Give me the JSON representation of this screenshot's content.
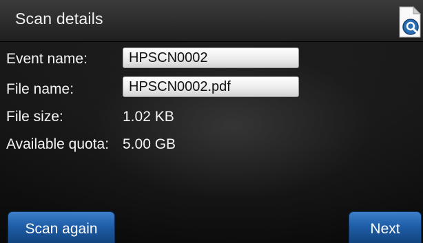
{
  "header": {
    "title": "Scan details",
    "help_icon": "help-search-icon"
  },
  "details": {
    "event_name_label": "Event name:",
    "event_name_value": "HPSCN0002",
    "file_name_label": "File name:",
    "file_name_value": "HPSCN0002.pdf",
    "file_size_label": "File size:",
    "file_size_value": "1.02 KB",
    "quota_label": "Available quota:",
    "quota_value": "5.00 GB"
  },
  "buttons": {
    "scan_again": "Scan again",
    "next": "Next"
  },
  "colors": {
    "accent_button": "#1f5ea8",
    "background": "#161616",
    "field_background": "#ececec"
  }
}
